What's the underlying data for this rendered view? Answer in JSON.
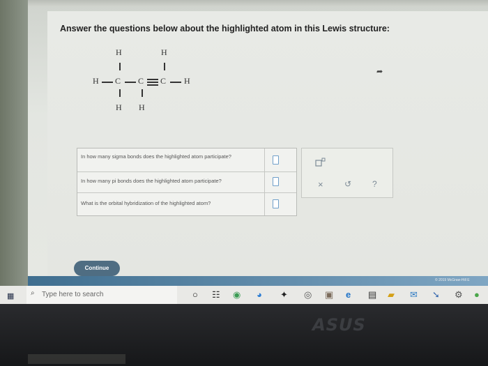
{
  "question_heading": "Answer the questions below about the highlighted atom in this Lewis structure:",
  "lewis": {
    "atoms": {
      "h_top_left": "H",
      "h_top_right": "H",
      "h_left": "H",
      "c1": "C",
      "c2": "C",
      "c3": "C",
      "h_right": "H",
      "h_bottom_left": "H",
      "h_bottom_right": "H"
    }
  },
  "questions": [
    {
      "text": "In how many sigma bonds does the highlighted atom participate?",
      "value": ""
    },
    {
      "text": "In how many pi bonds does the highlighted atom participate?",
      "value": ""
    },
    {
      "text": "What is the orbital hybridization of the highlighted atom?",
      "value": ""
    }
  ],
  "tools": {
    "superscript": "superscript-icon",
    "clear": "×",
    "undo": "↺",
    "help": "?"
  },
  "continue_label": "Continue",
  "copyright": "© 2019 McGraw-Hill E",
  "taskbar": {
    "search_placeholder": "Type here to search"
  },
  "brand": "ASUS",
  "colors": {
    "continue_button": "#4f6d82",
    "answer_box_border": "#6f9fc9",
    "taskbar_blue": "#3f6e8f"
  }
}
